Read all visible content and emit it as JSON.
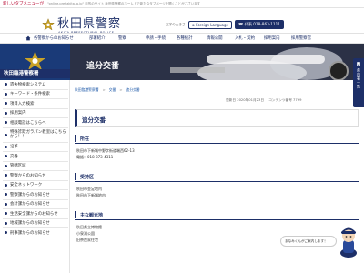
{
  "notice": {
    "label": "新しいタブメニューが",
    "text": "\"online.pref.akita.jp.jp\" 目的のサイト 秋田県警察のホーム上で新たなタブページを開くことがございます"
  },
  "header": {
    "title": "秋田県警察",
    "subtitle": "AKITA PREFECTURAL POLICE",
    "font_size_label": "文字の大きさ",
    "lang_button": "Foreign Language",
    "tel_button": "代表 018-863-1111"
  },
  "nav": {
    "items": [
      "各警察からのお知らせ",
      "部署紹介",
      "警察",
      "申請・手続",
      "各種統計",
      "情報公開",
      "入札・契約",
      "採用案内",
      "採用警察官"
    ]
  },
  "sidebar": {
    "title": "秋田臨港警察署",
    "items": [
      "遺失物検索システム",
      "キーワード・条件検索",
      "項目入力検索",
      "採用案内",
      "相談電話はこちらへ",
      "特殊詐欺ガラパン教室はこちらから！！",
      "沿革",
      "交番",
      "管轄区域",
      "警察からのお知らせ",
      "安全ネットワーク",
      "警察課からのお知らせ",
      "会計課からのお知らせ",
      "生活安全課からのお知らせ",
      "地域課からのお知らせ",
      "刑事課からのお知らせ"
    ]
  },
  "hero": {
    "title": "追分交番"
  },
  "breadcrumb": [
    "秋田臨港警察署",
    "交番",
    "追分交番"
  ],
  "meta": {
    "updated": "更新日 2020年01月23日",
    "content_no": "コンテンツ番号 7799"
  },
  "page": {
    "title": "追分交番"
  },
  "sections": [
    {
      "title": "所在",
      "lines": [
        "秋田市下新城中野字街道端西62-13",
        "電話：018-873-4311"
      ]
    },
    {
      "title": "受持区",
      "lines": [
        "秋田市金足地内",
        "秋田市下新城地内"
      ]
    },
    {
      "title": "主な観光地",
      "lines": [
        "秋田県立博物館",
        "小泉潟公園",
        "旧奈良家住宅"
      ]
    }
  ],
  "float_tab": {
    "text": "県内署一覧"
  },
  "chatbot": {
    "bubble": "まなみくんがご案内します！"
  },
  "colors": {
    "navy": "#1d2f68",
    "link": "#1d58a8",
    "notice": "#b5002b"
  }
}
